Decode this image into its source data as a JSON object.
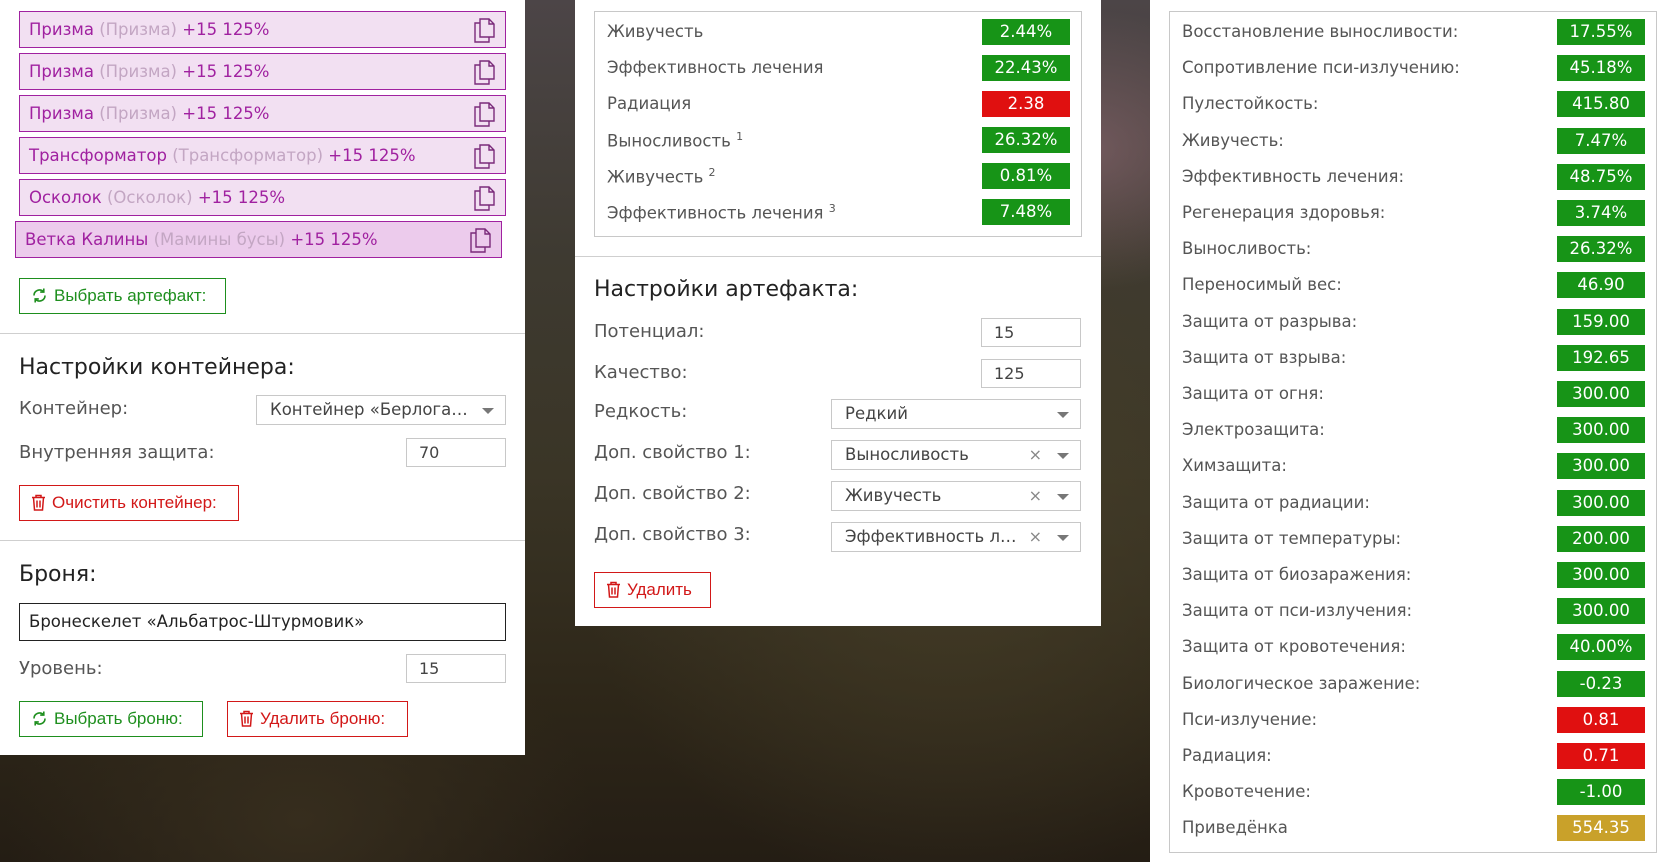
{
  "artifacts": [
    {
      "name": "Призма",
      "original": "(Призма)",
      "bonus": "+15 125%"
    },
    {
      "name": "Призма",
      "original": "(Призма)",
      "bonus": "+15 125%"
    },
    {
      "name": "Призма",
      "original": "(Призма)",
      "bonus": "+15 125%"
    },
    {
      "name": "Трансформатор",
      "original": "(Трансформатор)",
      "bonus": "+15 125%"
    },
    {
      "name": "Осколок",
      "original": "(Осколок)",
      "bonus": "+15 125%"
    },
    {
      "name": "Ветка Калины",
      "original": "(Мамины бусы)",
      "bonus": "+15 125%"
    }
  ],
  "left": {
    "select_artifact_label": "Выбрать артефакт:",
    "container_title": "Настройки контейнера:",
    "container_label": "Контейнер:",
    "container_value": "Контейнер «Берлога…",
    "inner_protection_label": "Внутренняя защита:",
    "inner_protection_value": "70",
    "clear_container_label": "Очистить контейнер:",
    "armor_title": "Броня:",
    "armor_name": "Бронескелет «Альбатрос-Штурмовик»",
    "level_label": "Уровень:",
    "level_value": "15",
    "select_armor_label": "Выбрать броню:",
    "delete_armor_label": "Удалить броню:"
  },
  "middle": {
    "stats": [
      {
        "name": "Живучесть",
        "sup": "",
        "value": "2.44%",
        "color": "green"
      },
      {
        "name": "Эффективность лечения",
        "sup": "",
        "value": "22.43%",
        "color": "green"
      },
      {
        "name": "Радиация",
        "sup": "",
        "value": "2.38",
        "color": "red"
      },
      {
        "name": "Выносливость",
        "sup": "1",
        "value": "26.32%",
        "color": "green"
      },
      {
        "name": "Живучесть",
        "sup": "2",
        "value": "0.81%",
        "color": "green"
      },
      {
        "name": "Эффективность лечения",
        "sup": "3",
        "value": "7.48%",
        "color": "green"
      }
    ],
    "settings_title": "Настройки артефакта:",
    "potential_label": "Потенциал:",
    "potential_value": "15",
    "quality_label": "Качество:",
    "quality_value": "125",
    "rarity_label": "Редкость:",
    "rarity_value": "Редкий",
    "prop1_label": "Доп. свойство 1:",
    "prop1_value": "Выносливость",
    "prop2_label": "Доп. свойство 2:",
    "prop2_value": "Живучесть",
    "prop3_label": "Доп. свойство 3:",
    "prop3_value": "Эффективность ле…",
    "clear_symbol": "×",
    "delete_label": "Удалить"
  },
  "right": {
    "stats": [
      {
        "name": "Восстановление выносливости:",
        "value": "17.55%",
        "color": "green"
      },
      {
        "name": "Сопротивление пси-излучению:",
        "value": "45.18%",
        "color": "green"
      },
      {
        "name": "Пулестойкость:",
        "value": "415.80",
        "color": "green"
      },
      {
        "name": "Живучесть:",
        "value": "7.47%",
        "color": "green"
      },
      {
        "name": "Эффективность лечения:",
        "value": "48.75%",
        "color": "green"
      },
      {
        "name": "Регенерация здоровья:",
        "value": "3.74%",
        "color": "green"
      },
      {
        "name": "Выносливость:",
        "value": "26.32%",
        "color": "green"
      },
      {
        "name": "Переносимый вес:",
        "value": "46.90",
        "color": "green"
      },
      {
        "name": "Защита от разрыва:",
        "value": "159.00",
        "color": "green"
      },
      {
        "name": "Защита от взрыва:",
        "value": "192.65",
        "color": "green"
      },
      {
        "name": "Защита от огня:",
        "value": "300.00",
        "color": "green"
      },
      {
        "name": "Электрозащита:",
        "value": "300.00",
        "color": "green"
      },
      {
        "name": "Химзащита:",
        "value": "300.00",
        "color": "green"
      },
      {
        "name": "Защита от радиации:",
        "value": "300.00",
        "color": "green"
      },
      {
        "name": "Защита от температуры:",
        "value": "200.00",
        "color": "green"
      },
      {
        "name": "Защита от биозаражения:",
        "value": "300.00",
        "color": "green"
      },
      {
        "name": "Защита от пси-излучения:",
        "value": "300.00",
        "color": "green"
      },
      {
        "name": "Защита от кровотечения:",
        "value": "40.00%",
        "color": "green"
      },
      {
        "name": "Биологическое заражение:",
        "value": "-0.23",
        "color": "green"
      },
      {
        "name": "Пси-излучение:",
        "value": "0.81",
        "color": "red"
      },
      {
        "name": "Радиация:",
        "value": "0.71",
        "color": "red"
      },
      {
        "name": "Кровотечение:",
        "value": "-1.00",
        "color": "green"
      },
      {
        "name": "Приведёнка",
        "value": "554.35",
        "color": "gold"
      }
    ]
  },
  "colors": {
    "green": "#179417",
    "red": "#e01010",
    "gold": "#c9a12a",
    "artifact": "#a021a0"
  }
}
